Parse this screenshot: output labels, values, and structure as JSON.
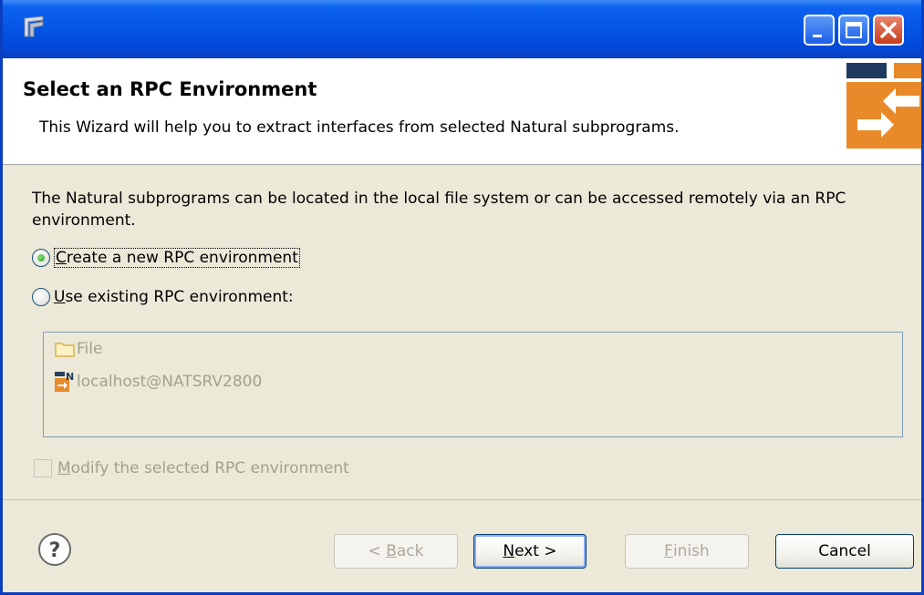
{
  "titlebar": {
    "app_icon": "eclipse-window-icon",
    "controls": [
      {
        "name": "minimize",
        "icon": "minimize-icon"
      },
      {
        "name": "maximize",
        "icon": "maximize-icon"
      },
      {
        "name": "close",
        "icon": "close-icon"
      }
    ]
  },
  "header": {
    "title": "Select an RPC Environment",
    "description": "This Wizard will help you to extract interfaces from selected Natural subprograms.",
    "icon": "rpc-wizard-banner-icon"
  },
  "body": {
    "intro": "The Natural subprograms can be located in the local file system or can be accessed remotely via an RPC environment.",
    "radio_new": {
      "label_first": "C",
      "label_rest": "reate a new RPC environment",
      "selected": true
    },
    "radio_existing": {
      "label_first": "U",
      "label_rest": "se existing RPC environment:",
      "selected": false
    },
    "environments": [
      {
        "label": "File",
        "icon": "folder-icon"
      },
      {
        "label": "localhost@NATSRV2800",
        "icon": "natural-server-icon"
      }
    ],
    "modify_checkbox": {
      "label_first": "M",
      "label_rest": "odify the selected RPC environment",
      "checked": false
    }
  },
  "footer": {
    "help_icon": "help-icon",
    "back": {
      "prefix": "< ",
      "mnemonic": "B",
      "rest": "ack"
    },
    "next": {
      "mnemonic": "N",
      "rest": "ext >"
    },
    "finish": {
      "mnemonic": "F",
      "rest": "inish"
    },
    "cancel": "Cancel"
  },
  "colors": {
    "titlebar": "#0556e6",
    "dialog_bg": "#ece9d8",
    "banner_orange": "#e98a2a",
    "disabled_text": "#a2a08e"
  }
}
